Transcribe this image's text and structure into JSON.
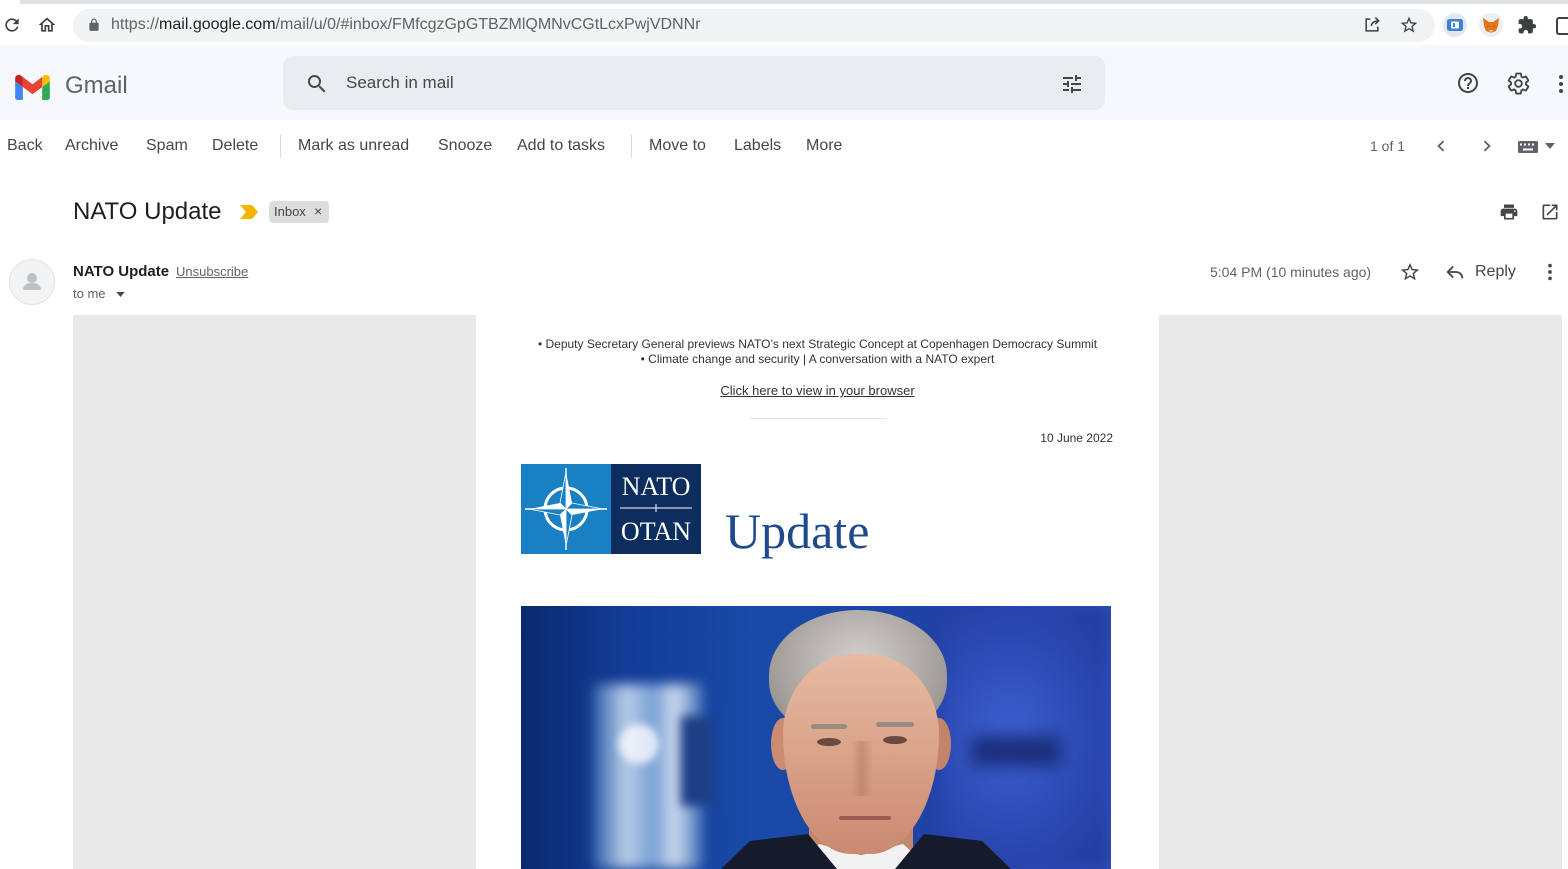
{
  "browser": {
    "url_scheme": "https://",
    "url_domain": "mail.google.com",
    "url_path": "/mail/u/0/#inbox/FMfcgzGpGTBZMlQMNvCGtLcxPwjVDNNr"
  },
  "gmail": {
    "product_name": "Gmail",
    "search_placeholder": "Search in mail"
  },
  "toolbar": {
    "back": "Back",
    "archive": "Archive",
    "spam": "Spam",
    "delete": "Delete",
    "mark_unread": "Mark as unread",
    "snooze": "Snooze",
    "add_to_tasks": "Add to tasks",
    "move_to": "Move to",
    "labels": "Labels",
    "more": "More",
    "pagination": "1 of 1"
  },
  "message": {
    "subject": "NATO Update",
    "label_chip": "Inbox",
    "label_remove": "×",
    "sender_name": "NATO Update",
    "unsubscribe": "Unsubscribe",
    "recipient": "to me",
    "time": "5:04 PM (10 minutes ago)",
    "reply": "Reply"
  },
  "email_body": {
    "bullets": [
      "• Deputy Secretary General previews NATO’s next Strategic Concept at Copenhagen Democracy Summit",
      "• Climate change and security | A conversation with a NATO expert"
    ],
    "view_in_browser": "Click here to view in your browser",
    "date": "10 June 2022",
    "logo_top": "NATO",
    "logo_bottom": "OTAN",
    "banner_title": "Update"
  },
  "icons": {
    "browser": [
      "reload-icon",
      "home-icon",
      "lock-icon",
      "share-icon",
      "bookmark-star-icon",
      "extension-icon",
      "metamask-fox-icon",
      "puzzle-extensions-icon",
      "side-panel-icon"
    ],
    "header": [
      "gmail-logo-icon",
      "search-icon",
      "search-options-icon",
      "help-icon",
      "settings-icon",
      "apps-icon"
    ],
    "toolbar": [
      "chevron-left-icon",
      "chevron-right-icon",
      "keyboard-icon",
      "dropdown-icon"
    ],
    "message": [
      "importance-marker-icon",
      "print-icon",
      "open-in-new-window-icon",
      "avatar-person-icon",
      "chevron-down-icon",
      "star-icon",
      "reply-icon",
      "more-vert-icon"
    ]
  },
  "colors": {
    "header_bg": "#f6f8fc",
    "search_bg": "#e9ecf1",
    "importance_marker": "#f4b400",
    "nato_blue": "#1a80c4",
    "nato_navy": "#0d2d5e",
    "update_title": "#1f4a8c",
    "email_side_panels": "#e9e9e9"
  }
}
